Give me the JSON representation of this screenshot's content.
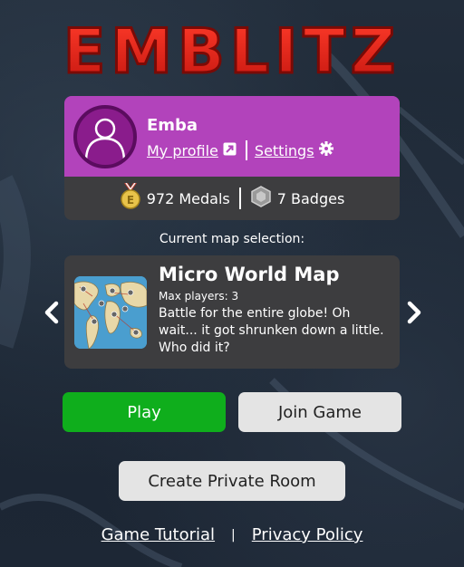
{
  "logo": {
    "text": "EMBLITZ",
    "color": "#e8261d"
  },
  "profile": {
    "username": "Emba",
    "my_profile_label": "My profile",
    "settings_label": "Settings",
    "medals_label": "972 Medals",
    "badges_label": "7 Badges",
    "header_color": "#b243bb"
  },
  "map": {
    "caption": "Current map selection:",
    "name": "Micro World Map",
    "max_players": "Max players: 3",
    "description": "Battle for the entire globe! Oh wait... it got shrunken down a little. Who did it?"
  },
  "buttons": {
    "play": "Play",
    "join": "Join Game",
    "private_room": "Create Private Room"
  },
  "footer": {
    "tutorial": "Game Tutorial",
    "separator": "|",
    "privacy": "Privacy Policy"
  },
  "icons": {
    "prev": "chevron-left-icon",
    "next": "chevron-right-icon",
    "external": "external-link-icon",
    "settings": "gear-icon",
    "medal": "medal-icon",
    "badge": "badge-icon"
  }
}
